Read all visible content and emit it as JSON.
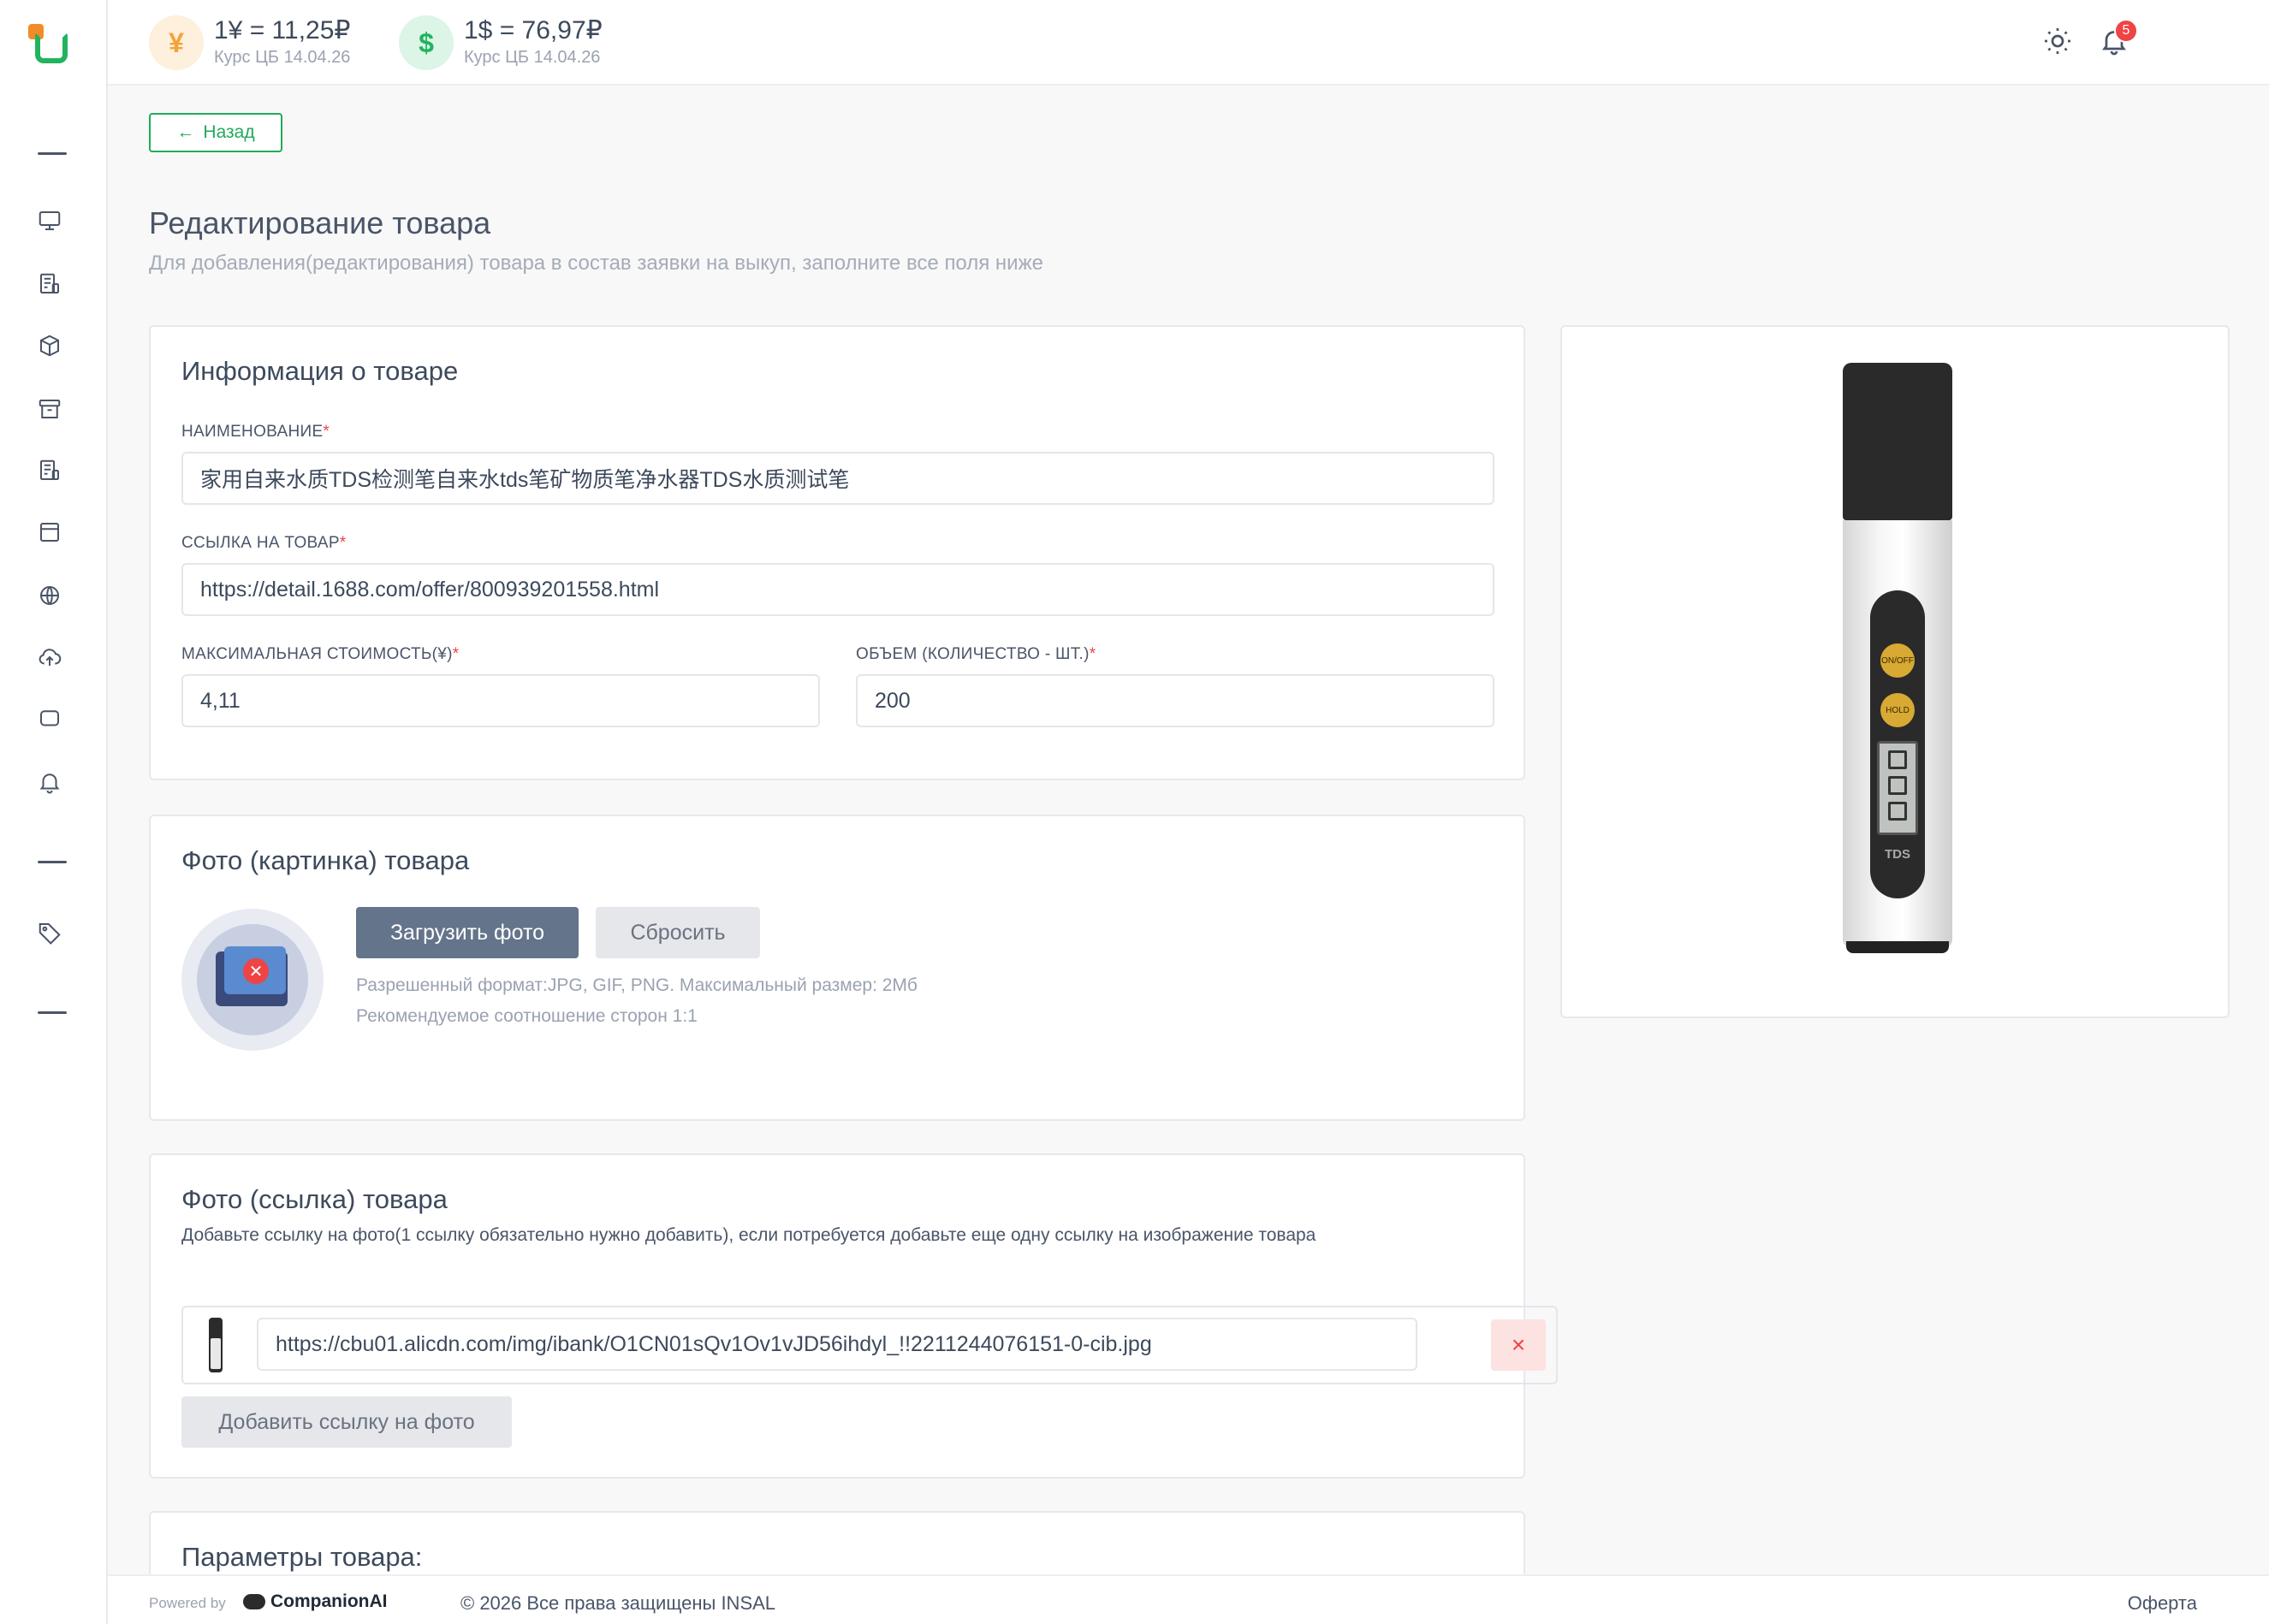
{
  "header": {
    "rates": [
      {
        "symbol": "¥",
        "value": "1¥ = 11,25₽",
        "sub": "Курс ЦБ 14.04.26",
        "icon": "yen-icon"
      },
      {
        "symbol": "$",
        "value": "1$ = 76,97₽",
        "sub": "Курс ЦБ 14.04.26",
        "icon": "dollar-icon"
      }
    ],
    "notifications_count": "5"
  },
  "sidebar": {
    "icons": [
      "monitor-icon",
      "document-icon",
      "box-icon",
      "archive-icon",
      "document-list-icon",
      "calendar-icon",
      "globe-icon",
      "cloud-upload-icon",
      "chat-icon",
      "bell-icon",
      "tag-icon"
    ]
  },
  "page": {
    "back_label": "Назад",
    "title": "Редактирование товара",
    "subtitle": "Для добавления(редактирования) товара в состав заявки на выкуп, заполните все поля ниже"
  },
  "info_card": {
    "title": "Информация о товаре",
    "name_label": "НАИМЕНОВАНИЕ",
    "name_value": "家用自来水质TDS检测笔自来水tds笔矿物质笔净水器TDS水质测试笔",
    "link_label": "ССЫЛКА НА ТОВАР",
    "link_value": "https://detail.1688.com/offer/800939201558.html",
    "price_label": "МАКСИМАЛЬНАЯ СТОИМОСТЬ(¥)",
    "price_value": "4,11",
    "qty_label": "ОБЪЕМ (КОЛИЧЕСТВО - ШТ.)",
    "qty_value": "200",
    "required_mark": "*"
  },
  "photo_card": {
    "title": "Фото (картинка) товара",
    "upload_label": "Загрузить фото",
    "reset_label": "Сбросить",
    "hint1": "Разрешенный формат:JPG, GIF, PNG. Максимальный размер: 2Мб",
    "hint2": "Рекомендуемое соотношение сторон 1:1"
  },
  "photo_link_card": {
    "title": "Фото (ссылка) товара",
    "description": "Добавьте ссылку на фото(1 ссылку обязательно нужно добавить), если потребуется добавьте еще одну ссылку на изображение товара",
    "link_value": "https://cbu01.alicdn.com/img/ibank/O1CN01sQv1Ov1vJD56ihdyl_!!2211244076151-0-cib.jpg",
    "delete_label": "×",
    "add_label": "Добавить ссылку на фото"
  },
  "params_card": {
    "title": "Параметры товара:"
  },
  "product_image": {
    "caption": "TDS",
    "btn1": "ON/OFF",
    "btn2": "HOLD"
  },
  "footer": {
    "powered": "Powered by",
    "brand": "CompanionAI",
    "copyright": "© 2026 Все права защищены INSAL",
    "offer": "Оферта"
  }
}
